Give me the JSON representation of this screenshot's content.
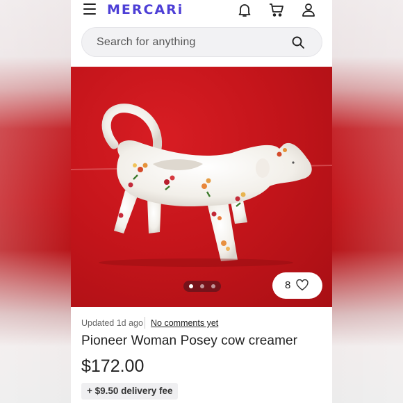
{
  "app": {
    "logo": "MERCARi",
    "brand_color": "#4d3fd6"
  },
  "header": {
    "icons": [
      "menu-icon",
      "bell-icon",
      "cart-icon",
      "user-icon"
    ]
  },
  "search": {
    "placeholder": "Search for anything",
    "icon": "search-icon"
  },
  "gallery": {
    "image_count": 3,
    "active_index": 0,
    "like_count": "8",
    "like_icon": "heart-icon"
  },
  "listing": {
    "updated": "Updated 1d ago",
    "comments_link": "No comments yet",
    "title": "Pioneer Woman Posey cow creamer",
    "price": "$172.00",
    "delivery_fee": "+ $9.50 delivery fee"
  }
}
